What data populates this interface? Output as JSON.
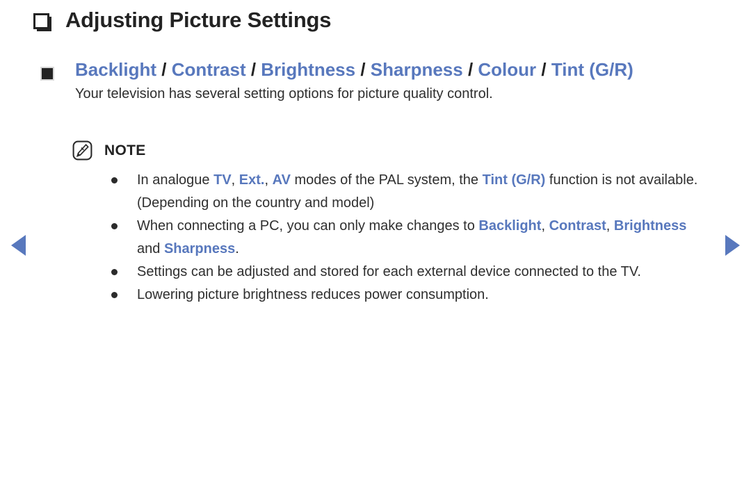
{
  "document": {
    "title": "Adjusting Picture Settings",
    "title_bullet_icon": "hollow-square-3d-icon"
  },
  "section": {
    "bullet_icon": "filled-square-icon",
    "heading_parts": [
      {
        "text": "Backlight",
        "style": "term"
      },
      {
        "text": " / ",
        "style": "sep"
      },
      {
        "text": "Contrast",
        "style": "term"
      },
      {
        "text": " / ",
        "style": "sep"
      },
      {
        "text": "Brightness",
        "style": "term"
      },
      {
        "text": " / ",
        "style": "sep"
      },
      {
        "text": "Sharpness",
        "style": "term"
      },
      {
        "text": " / ",
        "style": "sep"
      },
      {
        "text": "Colour",
        "style": "term"
      },
      {
        "text": " / ",
        "style": "sep"
      },
      {
        "text": "Tint (G/R)",
        "style": "term"
      }
    ],
    "heading_plain": "Backlight / Contrast / Brightness / Sharpness / Colour / Tint (G/R)",
    "description": "Your television has several setting options for picture quality control."
  },
  "note": {
    "icon": "note-pencil-icon",
    "label": "NOTE",
    "items": [
      {
        "bullet_icon": "bullet-dot-icon",
        "plain": "In analogue TV, Ext., AV modes of the PAL system, the Tint (G/R) function is not available. (Depending on the country and model)",
        "parts": [
          {
            "text": "In analogue ",
            "style": "plain"
          },
          {
            "text": "TV",
            "style": "keyword"
          },
          {
            "text": ", ",
            "style": "plain"
          },
          {
            "text": "Ext.",
            "style": "keyword"
          },
          {
            "text": ", ",
            "style": "plain"
          },
          {
            "text": "AV",
            "style": "keyword"
          },
          {
            "text": " modes of the PAL system, the ",
            "style": "plain"
          },
          {
            "text": "Tint (G/R)",
            "style": "keyword"
          },
          {
            "text": " function is not available. (Depending on the country and model)",
            "style": "plain"
          }
        ]
      },
      {
        "bullet_icon": "bullet-dot-icon",
        "plain": "When connecting a PC, you can only make changes to Backlight, Contrast, Brightness and Sharpness.",
        "parts": [
          {
            "text": "When connecting a PC, you can only make changes to ",
            "style": "plain"
          },
          {
            "text": "Backlight",
            "style": "keyword"
          },
          {
            "text": ", ",
            "style": "plain"
          },
          {
            "text": "Contrast",
            "style": "keyword"
          },
          {
            "text": ", ",
            "style": "plain"
          },
          {
            "text": "Brightness",
            "style": "keyword"
          },
          {
            "text": " and ",
            "style": "plain"
          },
          {
            "text": "Sharpness",
            "style": "keyword"
          },
          {
            "text": ".",
            "style": "plain"
          }
        ]
      },
      {
        "bullet_icon": "bullet-dot-icon",
        "plain": "Settings can be adjusted and stored for each external device connected to the TV.",
        "parts": [
          {
            "text": "Settings can be adjusted and stored for each external device connected to the TV.",
            "style": "plain"
          }
        ]
      },
      {
        "bullet_icon": "bullet-dot-icon",
        "plain": "Lowering picture brightness reduces power consumption.",
        "parts": [
          {
            "text": "Lowering picture brightness reduces power consumption.",
            "style": "plain"
          }
        ]
      }
    ]
  },
  "navigation": {
    "prev_icon": "triangle-left-icon",
    "next_icon": "triangle-right-icon",
    "prev_label": "",
    "next_label": ""
  },
  "colors": {
    "keyword_blue": "#5878bd",
    "text_dark": "#2f2f2f",
    "background": "#ffffff"
  }
}
